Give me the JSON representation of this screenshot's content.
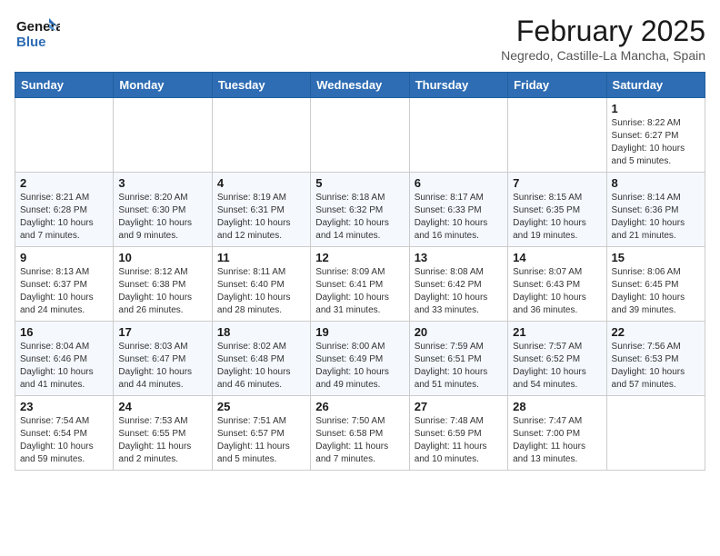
{
  "logo": {
    "line1": "General",
    "line2": "Blue"
  },
  "title": "February 2025",
  "subtitle": "Negredo, Castille-La Mancha, Spain",
  "weekdays": [
    "Sunday",
    "Monday",
    "Tuesday",
    "Wednesday",
    "Thursday",
    "Friday",
    "Saturday"
  ],
  "weeks": [
    [
      {
        "day": "",
        "info": ""
      },
      {
        "day": "",
        "info": ""
      },
      {
        "day": "",
        "info": ""
      },
      {
        "day": "",
        "info": ""
      },
      {
        "day": "",
        "info": ""
      },
      {
        "day": "",
        "info": ""
      },
      {
        "day": "1",
        "info": "Sunrise: 8:22 AM\nSunset: 6:27 PM\nDaylight: 10 hours\nand 5 minutes."
      }
    ],
    [
      {
        "day": "2",
        "info": "Sunrise: 8:21 AM\nSunset: 6:28 PM\nDaylight: 10 hours\nand 7 minutes."
      },
      {
        "day": "3",
        "info": "Sunrise: 8:20 AM\nSunset: 6:30 PM\nDaylight: 10 hours\nand 9 minutes."
      },
      {
        "day": "4",
        "info": "Sunrise: 8:19 AM\nSunset: 6:31 PM\nDaylight: 10 hours\nand 12 minutes."
      },
      {
        "day": "5",
        "info": "Sunrise: 8:18 AM\nSunset: 6:32 PM\nDaylight: 10 hours\nand 14 minutes."
      },
      {
        "day": "6",
        "info": "Sunrise: 8:17 AM\nSunset: 6:33 PM\nDaylight: 10 hours\nand 16 minutes."
      },
      {
        "day": "7",
        "info": "Sunrise: 8:15 AM\nSunset: 6:35 PM\nDaylight: 10 hours\nand 19 minutes."
      },
      {
        "day": "8",
        "info": "Sunrise: 8:14 AM\nSunset: 6:36 PM\nDaylight: 10 hours\nand 21 minutes."
      }
    ],
    [
      {
        "day": "9",
        "info": "Sunrise: 8:13 AM\nSunset: 6:37 PM\nDaylight: 10 hours\nand 24 minutes."
      },
      {
        "day": "10",
        "info": "Sunrise: 8:12 AM\nSunset: 6:38 PM\nDaylight: 10 hours\nand 26 minutes."
      },
      {
        "day": "11",
        "info": "Sunrise: 8:11 AM\nSunset: 6:40 PM\nDaylight: 10 hours\nand 28 minutes."
      },
      {
        "day": "12",
        "info": "Sunrise: 8:09 AM\nSunset: 6:41 PM\nDaylight: 10 hours\nand 31 minutes."
      },
      {
        "day": "13",
        "info": "Sunrise: 8:08 AM\nSunset: 6:42 PM\nDaylight: 10 hours\nand 33 minutes."
      },
      {
        "day": "14",
        "info": "Sunrise: 8:07 AM\nSunset: 6:43 PM\nDaylight: 10 hours\nand 36 minutes."
      },
      {
        "day": "15",
        "info": "Sunrise: 8:06 AM\nSunset: 6:45 PM\nDaylight: 10 hours\nand 39 minutes."
      }
    ],
    [
      {
        "day": "16",
        "info": "Sunrise: 8:04 AM\nSunset: 6:46 PM\nDaylight: 10 hours\nand 41 minutes."
      },
      {
        "day": "17",
        "info": "Sunrise: 8:03 AM\nSunset: 6:47 PM\nDaylight: 10 hours\nand 44 minutes."
      },
      {
        "day": "18",
        "info": "Sunrise: 8:02 AM\nSunset: 6:48 PM\nDaylight: 10 hours\nand 46 minutes."
      },
      {
        "day": "19",
        "info": "Sunrise: 8:00 AM\nSunset: 6:49 PM\nDaylight: 10 hours\nand 49 minutes."
      },
      {
        "day": "20",
        "info": "Sunrise: 7:59 AM\nSunset: 6:51 PM\nDaylight: 10 hours\nand 51 minutes."
      },
      {
        "day": "21",
        "info": "Sunrise: 7:57 AM\nSunset: 6:52 PM\nDaylight: 10 hours\nand 54 minutes."
      },
      {
        "day": "22",
        "info": "Sunrise: 7:56 AM\nSunset: 6:53 PM\nDaylight: 10 hours\nand 57 minutes."
      }
    ],
    [
      {
        "day": "23",
        "info": "Sunrise: 7:54 AM\nSunset: 6:54 PM\nDaylight: 10 hours\nand 59 minutes."
      },
      {
        "day": "24",
        "info": "Sunrise: 7:53 AM\nSunset: 6:55 PM\nDaylight: 11 hours\nand 2 minutes."
      },
      {
        "day": "25",
        "info": "Sunrise: 7:51 AM\nSunset: 6:57 PM\nDaylight: 11 hours\nand 5 minutes."
      },
      {
        "day": "26",
        "info": "Sunrise: 7:50 AM\nSunset: 6:58 PM\nDaylight: 11 hours\nand 7 minutes."
      },
      {
        "day": "27",
        "info": "Sunrise: 7:48 AM\nSunset: 6:59 PM\nDaylight: 11 hours\nand 10 minutes."
      },
      {
        "day": "28",
        "info": "Sunrise: 7:47 AM\nSunset: 7:00 PM\nDaylight: 11 hours\nand 13 minutes."
      },
      {
        "day": "",
        "info": ""
      }
    ]
  ]
}
